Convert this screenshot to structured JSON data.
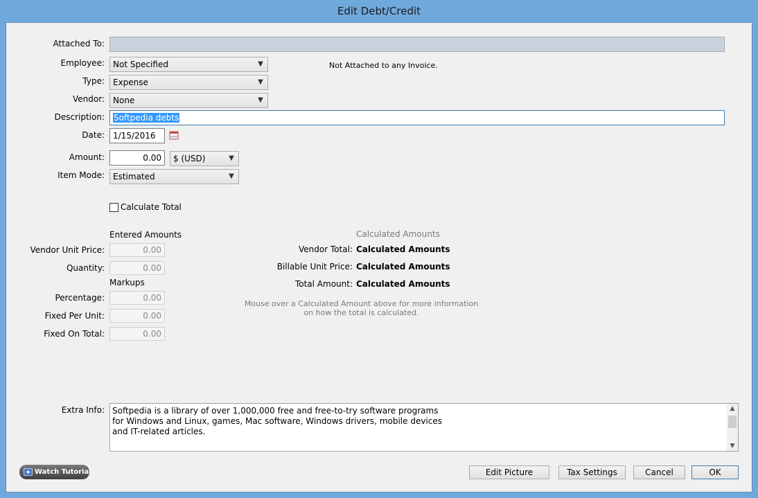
{
  "window": {
    "title": "Edit Debt/Credit"
  },
  "form": {
    "attached_to_label": "Attached To:",
    "employee_label": "Employee:",
    "employee_value": "Not Specified",
    "not_attached_text": "Not Attached to any Invoice.",
    "type_label": "Type:",
    "type_value": "Expense",
    "vendor_label": "Vendor:",
    "vendor_value": "None",
    "description_label": "Description:",
    "description_value": "Softpedia debts",
    "date_label": "Date:",
    "date_value": "1/15/2016",
    "amount_label": "Amount:",
    "amount_value": "0.00",
    "currency_value": "$ (USD)",
    "item_mode_label": "Item Mode:",
    "item_mode_value": "Estimated",
    "calculate_total_label": "Calculate Total",
    "calculate_total_checked": false
  },
  "entered": {
    "heading": "Entered Amounts",
    "vendor_unit_price_label": "Vendor Unit Price:",
    "vendor_unit_price_value": "0.00",
    "quantity_label": "Quantity:",
    "quantity_value": "0.00",
    "markups_heading": "Markups",
    "percentage_label": "Percentage:",
    "percentage_value": "0.00",
    "fixed_per_unit_label": "Fixed Per Unit:",
    "fixed_per_unit_value": "0.00",
    "fixed_on_total_label": "Fixed On Total:",
    "fixed_on_total_value": "0.00"
  },
  "calculated": {
    "heading": "Calculated Amounts",
    "vendor_total_label": "Vendor Total:",
    "vendor_total_value": "Calculated Amounts",
    "billable_unit_price_label": "Billable Unit Price:",
    "billable_unit_price_value": "Calculated Amounts",
    "total_amount_label": "Total Amount:",
    "total_amount_value": "Calculated Amounts",
    "hint_line1": "Mouse over a Calculated Amount above for more information",
    "hint_line2": "on how the total is calculated."
  },
  "extra_info": {
    "label": "Extra Info:",
    "line1": "Softpedia is a library of over 1,000,000 free and free-to-try software programs",
    "line2": "for Windows and Linux, games, Mac software, Windows drivers, mobile devices",
    "line3": "and IT-related articles."
  },
  "buttons": {
    "watch_tutorial": "Watch Tutorial",
    "edit_picture": "Edit Picture",
    "tax_settings": "Tax Settings",
    "cancel": "Cancel",
    "ok": "OK"
  },
  "colors": {
    "titlebar": "#6fa9dc",
    "selection": "#3399ff"
  }
}
